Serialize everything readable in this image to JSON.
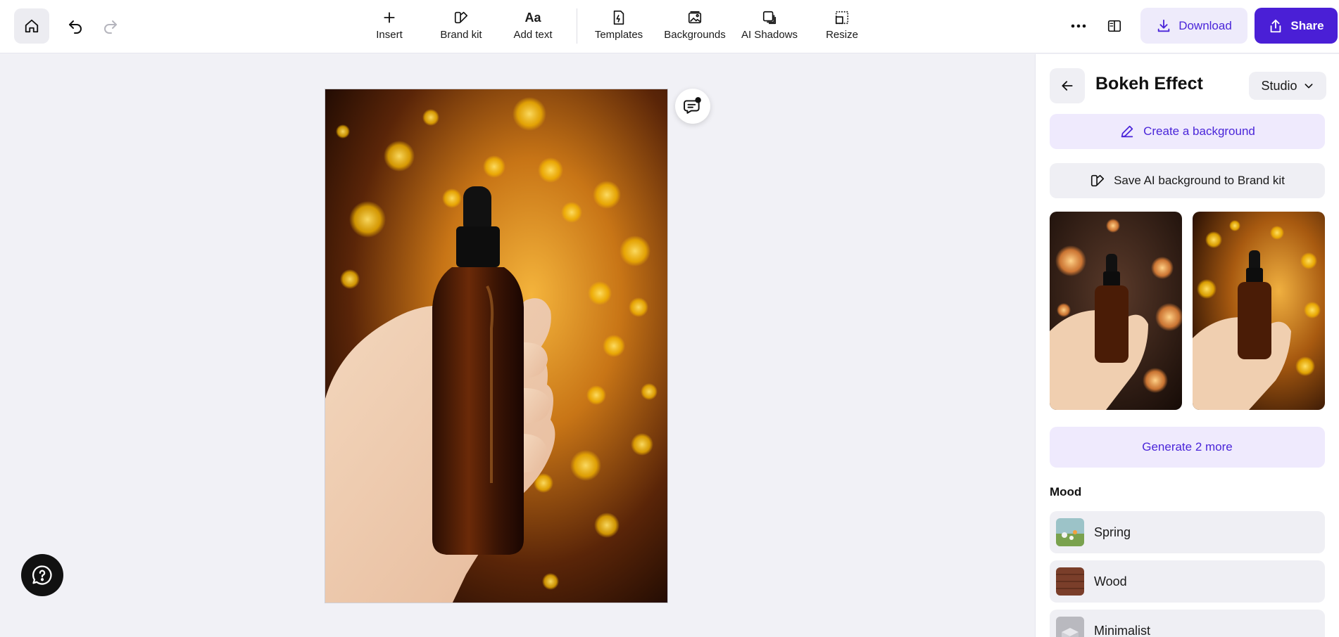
{
  "toolbar": {
    "home_icon": "home-icon",
    "undo_icon": "undo-icon",
    "redo_icon": "redo-icon",
    "tools": [
      {
        "label": "Insert",
        "icon": "plus-icon"
      },
      {
        "label": "Brand kit",
        "icon": "brand-kit-icon"
      },
      {
        "label": "Add text",
        "icon": "text-icon"
      },
      {
        "label": "Templates",
        "icon": "templates-icon"
      },
      {
        "label": "Backgrounds",
        "icon": "backgrounds-icon"
      },
      {
        "label": "AI Shadows",
        "icon": "shadows-icon"
      },
      {
        "label": "Resize",
        "icon": "resize-icon"
      }
    ],
    "download_label": "Download",
    "share_label": "Share"
  },
  "panel": {
    "title": "Bokeh Effect",
    "mode_select": "Studio",
    "create_background_label": "Create a background",
    "save_brand_kit_label": "Save AI background to Brand kit",
    "generate_more_label": "Generate 2 more",
    "mood_heading": "Mood",
    "mood_items": [
      {
        "label": "Spring"
      },
      {
        "label": "Wood"
      },
      {
        "label": "Minimalist"
      }
    ]
  },
  "colors": {
    "accent": "#4a1fd6",
    "accent_light": "#efeafd",
    "canvas_bg": "#f1f1f6"
  }
}
